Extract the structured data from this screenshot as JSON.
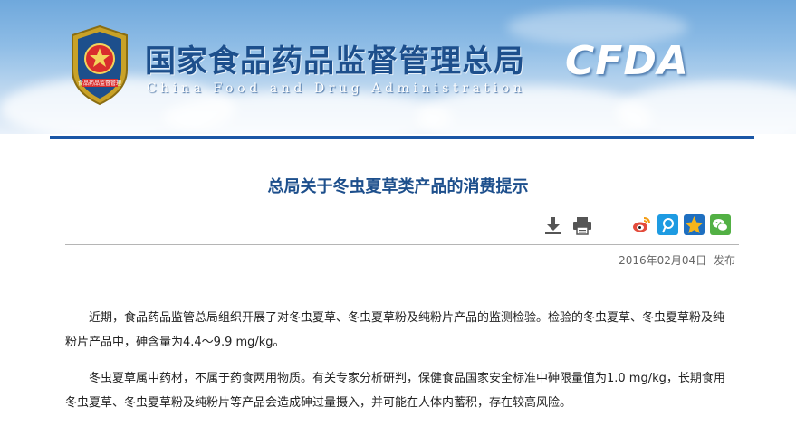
{
  "header": {
    "title_cn": "国家食品药品监督管理总局",
    "title_en": "China Food and Drug Administration",
    "logo_text": "CFDA",
    "emblem_text": "食品药品监督管理"
  },
  "article": {
    "title": "总局关于冬虫夏草类产品的消费提示",
    "date": "2016年02月04日",
    "published_label": "发布",
    "paragraphs": [
      "近期，食品药品监管总局组织开展了对冬虫夏草、冬虫夏草粉及纯粉片产品的监测检验。检验的冬虫夏草、冬虫夏草粉及纯粉片产品中，砷含量为4.4～9.9 mg/kg。",
      "冬虫夏草属中药材，不属于药食两用物质。有关专家分析研判，保健食品国家安全标准中砷限量值为1.0 mg/kg，长期食用冬虫夏草、冬虫夏草粉及纯粉片等产品会造成砷过量摄入，并可能在人体内蓄积，存在较高风险。"
    ]
  },
  "tools": {
    "download_icon": "download-icon",
    "print_icon": "print-icon"
  },
  "share": {
    "icons": [
      "weibo-icon",
      "tencent-weibo-icon",
      "qzone-icon",
      "wechat-icon"
    ],
    "colors": {
      "weibo": "#e34b3b",
      "tencent": "#1e9be2",
      "qzone": "#f6b51b",
      "wechat": "#52b044"
    }
  },
  "colors": {
    "brand_blue": "#1a56a6",
    "title_blue": "#1d4f8c"
  }
}
